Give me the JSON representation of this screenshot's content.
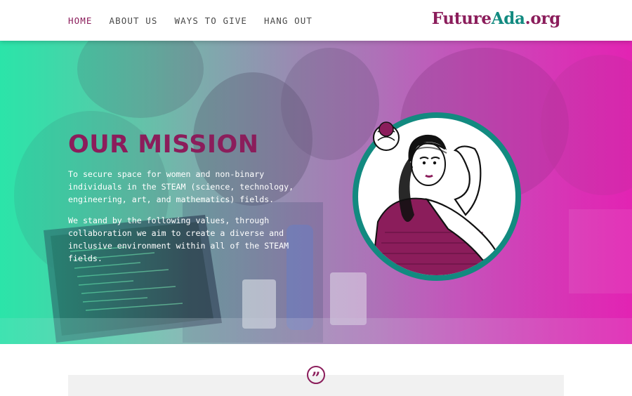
{
  "nav": {
    "items": [
      {
        "label": "HOME",
        "active": true
      },
      {
        "label": "ABOUT US",
        "active": false
      },
      {
        "label": "WAYS TO GIVE",
        "active": false
      },
      {
        "label": "HANG OUT",
        "active": false
      }
    ]
  },
  "logo": {
    "part1": "Future",
    "part2": "Ada",
    "part3": ".org"
  },
  "hero": {
    "title": "OUR MISSION",
    "paragraph1": "To secure space for women and non-binary individuals in the STEAM (science, technology, engineering, art, and mathematics) fields.",
    "paragraph2": "We stand by the following values, through collaboration we aim to create a diverse and inclusive environment within all of the STEAM fields."
  },
  "quote": {
    "icon": "quote-icon",
    "glyph": "”"
  },
  "colors": {
    "brand_plum": "#8b1d5b",
    "brand_teal": "#128a80",
    "gradient_left": "#2fe2a8",
    "gradient_right": "#e02ab4"
  }
}
